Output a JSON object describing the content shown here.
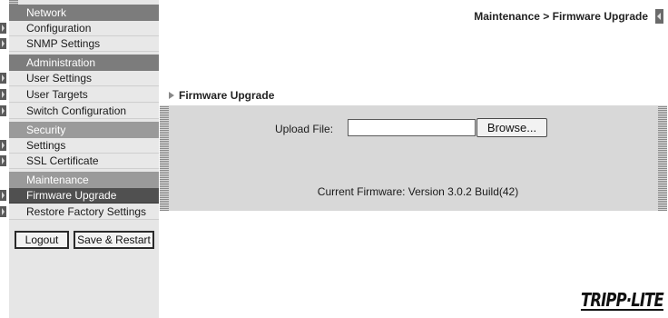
{
  "header": {
    "breadcrumb": "Maintenance > Firmware Upgrade"
  },
  "sidebar": {
    "sections": [
      {
        "title": "Network",
        "items": [
          "Configuration",
          "SNMP Settings"
        ]
      },
      {
        "title": "Administration",
        "items": [
          "User Settings",
          "User Targets",
          "Switch Configuration"
        ]
      },
      {
        "title": "Security",
        "items": [
          "Settings",
          "SSL Certificate"
        ]
      },
      {
        "title": "Maintenance",
        "items": [
          "Firmware Upgrade",
          "Restore Factory Settings"
        ]
      }
    ],
    "active_item": "Firmware Upgrade",
    "logout_label": "Logout",
    "save_restart_label": "Save & Restart"
  },
  "main": {
    "panel_title": "Firmware Upgrade",
    "upload_label": "Upload File:",
    "upload_value": "",
    "browse_label": "Browse...",
    "current_firmware": "Current Firmware: Version 3.0.2 Build(42)"
  },
  "brand": {
    "logo_text": "TRIPP·LITE"
  }
}
